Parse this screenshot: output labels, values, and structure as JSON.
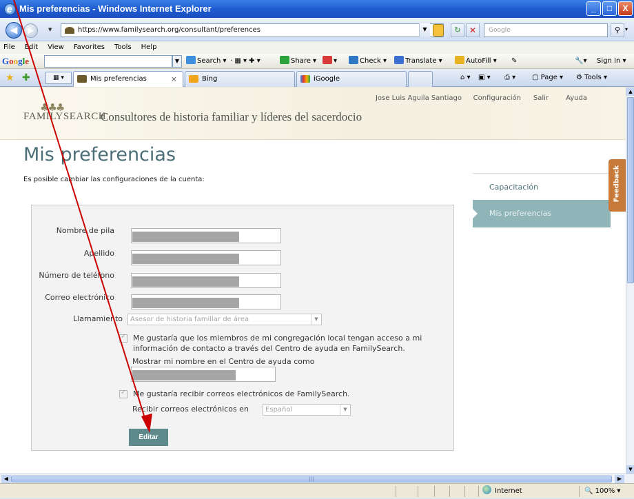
{
  "window": {
    "title": "Mis preferencias - Windows Internet Explorer",
    "controls": [
      "_",
      "□",
      "X"
    ]
  },
  "address_bar": {
    "url": "https://www.familysearch.org/consultant/preferences",
    "search_placeholder": "Google"
  },
  "menu": [
    "File",
    "Edit",
    "View",
    "Favorites",
    "Tools",
    "Help"
  ],
  "google_toolbar": {
    "logo": "Google",
    "items": [
      "Search ▾",
      "Share ▾",
      "Check ▾",
      "Translate ▾",
      "AutoFill ▾"
    ],
    "sign_in": "Sign In ▾"
  },
  "tabs": {
    "items": [
      {
        "label": "Mis preferencias"
      },
      {
        "label": "Bing"
      },
      {
        "label": "iGoogle"
      }
    ],
    "close": "×",
    "commands": [
      "Page ▾",
      "Tools ▾"
    ]
  },
  "site": {
    "logo": "FAMILYSEARCH",
    "subtitle": "Consultores de historia familiar y líderes del sacerdocio",
    "top_links": [
      "Jose Luis Aguila Santiago",
      "Configuración",
      "Salir",
      "Ayuda"
    ],
    "page_title": "Mis preferencias",
    "page_desc": "Es posible cambiar las configuraciones de la cuenta:"
  },
  "form": {
    "labels": {
      "first_name": "Nombre de pila",
      "last_name": "Apellido",
      "phone": "Número de teléfono",
      "email": "Correo electrónico",
      "calling": "Llamamiento"
    },
    "calling_value": "Asesor de historia familiar de área",
    "contact_checkbox_line1": "Me gustaría que los miembros de mi congregación local tengan acceso a mi",
    "contact_checkbox_line2": "información de contacto a través del Centro de ayuda en FamilySearch.",
    "display_name_label": "Mostrar mi nombre en el Centro de ayuda como",
    "email_checkbox": "Me gustaría recibir correos electrónicos de FamilySearch.",
    "email_lang_label": "Recibir correos electrónicos en",
    "email_lang_value": "Español",
    "edit_button": "Editar"
  },
  "sidenav": {
    "items": [
      "Capacitación",
      "Mis preferencias"
    ],
    "active": "Mis preferencias"
  },
  "feedback": "Feedback",
  "status": {
    "zone": "Internet",
    "zoom": "100%"
  },
  "colors": {
    "accent": "#5e8a8c",
    "sidenav_active": "#8fb5b8",
    "feedback": "#c87a3b",
    "arrow": "#cc0000"
  }
}
